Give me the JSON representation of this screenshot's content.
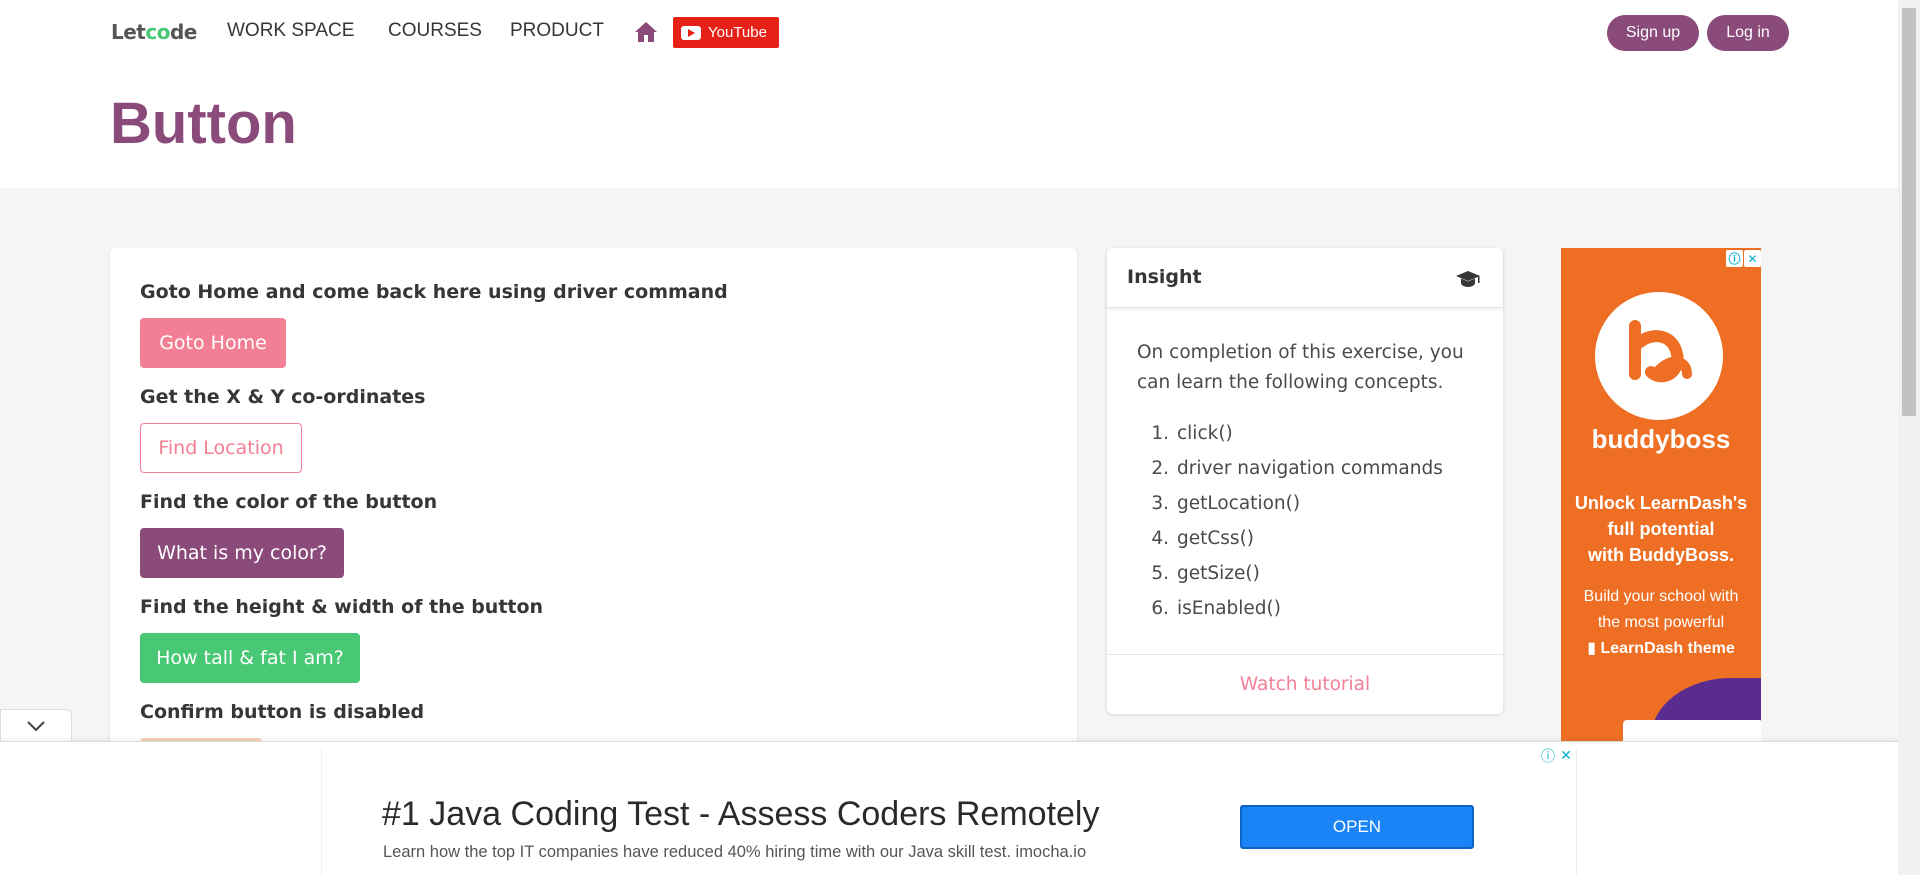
{
  "nav": {
    "logo_left": "Let",
    "logo_accent": "c",
    "logo_o": "o",
    "logo_right": "de",
    "links": [
      "WORK SPACE",
      "COURSES",
      "PRODUCT"
    ],
    "youtube_label": "YouTube",
    "signup_label": "Sign up",
    "login_label": "Log in",
    "accent_color": "#8a4a7a"
  },
  "hero": {
    "title": "Button"
  },
  "exercises": [
    {
      "label": "Goto Home and come back here using driver command",
      "button": "Goto Home"
    },
    {
      "label": "Get the X & Y co-ordinates",
      "button": "Find Location"
    },
    {
      "label": "Find the color of the button",
      "button": "What is my color?"
    },
    {
      "label": "Find the height & width of the button",
      "button": "How tall & fat I am?"
    },
    {
      "label": "Confirm button is disabled",
      "button": ""
    }
  ],
  "insight": {
    "title": "Insight",
    "icon": "graduation-cap-icon",
    "intro": "On completion of this exercise, you can learn the following concepts.",
    "concepts": [
      {
        "num": "1.",
        "text": "click()"
      },
      {
        "num": "2.",
        "text": "driver navigation commands"
      },
      {
        "num": "3.",
        "text": "getLocation()"
      },
      {
        "num": "4.",
        "text": "getCss()"
      },
      {
        "num": "5.",
        "text": "getSize()"
      },
      {
        "num": "6.",
        "text": "isEnabled()"
      }
    ],
    "footer_link": "Watch tutorial"
  },
  "side_ad": {
    "brand": "buddyboss",
    "headline_1": "Unlock LearnDash's",
    "headline_2": "full potential",
    "headline_3": "with BuddyBoss.",
    "sub_1": "Build your school with",
    "sub_2": "the most powerful",
    "sub_3": "LearnDash theme",
    "info_glyph": "ⓘ",
    "close_glyph": "✕"
  },
  "bottom_ad": {
    "title": "#1 Java Coding Test - Assess Coders Remotely",
    "text": "Learn how the top IT companies have reduced 40% hiring time with our Java skill test. imocha.io",
    "cta": "OPEN",
    "info_glyph": "ⓘ",
    "close_glyph": "✕"
  }
}
